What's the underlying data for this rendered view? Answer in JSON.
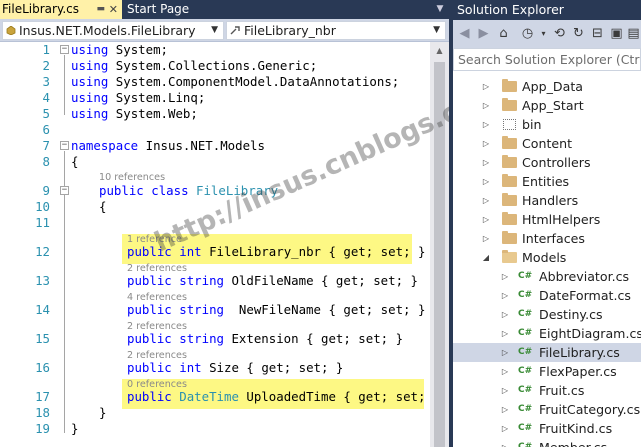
{
  "tabs": [
    {
      "label": "FileLibrary.cs",
      "active": true
    },
    {
      "label": "Start Page",
      "active": false
    }
  ],
  "navbar": {
    "class_combo": "Insus.NET.Models.FileLibrary",
    "member_combo": "FileLibrary_nbr"
  },
  "line_numbers": [
    "1",
    "2",
    "3",
    "4",
    "5",
    "6",
    "7",
    "8",
    "9",
    "10",
    "11",
    "12",
    "13",
    "14",
    "15",
    "16",
    "17",
    "18",
    "19"
  ],
  "code": {
    "using1": "System;",
    "using2": "System.Collections.Generic;",
    "using3": "System.ComponentModel.DataAnnotations;",
    "using4": "System.Linq;",
    "using5": "System.Web;",
    "kw_using": "using",
    "kw_namespace": "namespace",
    "namespace_name": "Insus.NET.Models",
    "open_brace": "{",
    "close_brace": "}",
    "kw_public": "public",
    "kw_class": "class",
    "class_name": "FileLibrary",
    "kw_int": "int",
    "kw_string": "string",
    "type_datetime": "DateTime",
    "accessor": "{ get; set; }",
    "kw_get": "get",
    "kw_set": "set",
    "prop_nbr": "FileLibrary_nbr",
    "prop_oldname": "OldFileName",
    "prop_newname": "NewFileName",
    "prop_ext": "Extension",
    "prop_size": "Size",
    "prop_time": "UploadedTime"
  },
  "refs": {
    "class_refs": "10 references",
    "nbr_refs": "1 reference",
    "old_refs": "2 references",
    "new_refs": "4 references",
    "ext_refs": "2 references",
    "size_refs": "2 references",
    "time_refs": "0 references"
  },
  "solution_explorer": {
    "title": "Solution Explorer",
    "search_placeholder": "Search Solution Explorer (Ctrl+;)",
    "items": [
      {
        "label": "App_Data",
        "kind": "folder"
      },
      {
        "label": "App_Start",
        "kind": "folder"
      },
      {
        "label": "bin",
        "kind": "hidden-folder"
      },
      {
        "label": "Content",
        "kind": "folder"
      },
      {
        "label": "Controllers",
        "kind": "folder"
      },
      {
        "label": "Entities",
        "kind": "folder"
      },
      {
        "label": "Handlers",
        "kind": "folder"
      },
      {
        "label": "HtmlHelpers",
        "kind": "folder"
      },
      {
        "label": "Interfaces",
        "kind": "folder"
      },
      {
        "label": "Models",
        "kind": "folder-open"
      },
      {
        "label": "Abbreviator.cs",
        "kind": "cs"
      },
      {
        "label": "DateFormat.cs",
        "kind": "cs"
      },
      {
        "label": "Destiny.cs",
        "kind": "cs"
      },
      {
        "label": "EightDiagram.cs",
        "kind": "cs"
      },
      {
        "label": "FileLibrary.cs",
        "kind": "cs",
        "selected": true
      },
      {
        "label": "FlexPaper.cs",
        "kind": "cs"
      },
      {
        "label": "Fruit.cs",
        "kind": "cs"
      },
      {
        "label": "FruitCategory.cs",
        "kind": "cs"
      },
      {
        "label": "FruitKind.cs",
        "kind": "cs"
      },
      {
        "label": "Member.cs",
        "kind": "cs"
      }
    ]
  },
  "watermark": "http://insus.cnblogs.com",
  "colors": {
    "keyword": "#0000ff",
    "type": "#2b91af",
    "highlight": "#fdf884",
    "chrome": "#293955",
    "active_tab": "#fff1a8"
  },
  "icons": {
    "cs_glyph": "C#"
  }
}
